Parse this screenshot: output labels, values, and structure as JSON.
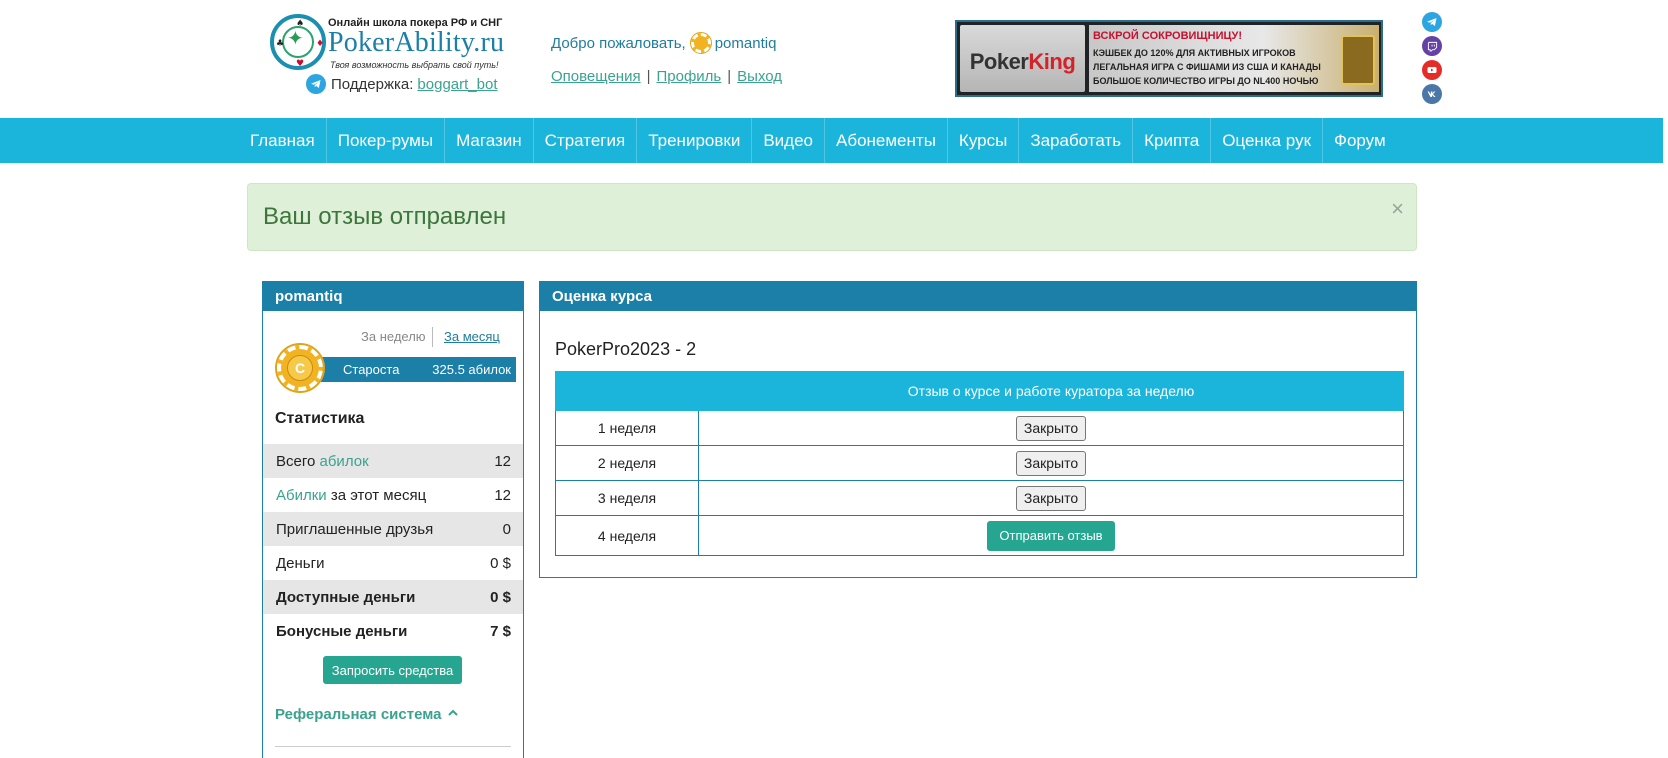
{
  "header": {
    "logo": {
      "top_line": "Онлайн школа покера РФ и СНГ",
      "name": "PokerAbility.ru",
      "slogan": "Твоя возможность выбрать свой путь!"
    },
    "support": {
      "label": "Поддержка:",
      "link": "boggart_bot"
    },
    "welcome": {
      "text": "Добро пожаловать,",
      "username": "pomantiq"
    },
    "user_links": {
      "notifications": "Оповещения",
      "profile": "Профиль",
      "logout": "Выход",
      "separator": "|"
    },
    "banner": {
      "brand_part1": "Poker",
      "brand_part2": "King",
      "title": "ВСКРОЙ СОКРОВИЩНИЦУ!",
      "lines": [
        "КЭШБЕК ДО 120% ДЛЯ АКТИВНЫХ ИГРОКОВ",
        "ЛЕГАЛЬНАЯ ИГРА С ФИШАМИ ИЗ США И КАНАДЫ",
        "БОЛЬШОЕ КОЛИЧЕСТВО ИГРЫ ДО NL400 НОЧЬЮ"
      ]
    },
    "social": [
      {
        "icon": "telegram-icon",
        "color": "#2ca5e0"
      },
      {
        "icon": "twitch-icon",
        "color": "#6441a5"
      },
      {
        "icon": "youtube-icon",
        "color": "#e52d27"
      },
      {
        "icon": "vk-icon",
        "color": "#4a76a8"
      }
    ]
  },
  "nav": {
    "items": [
      "Главная",
      "Покер-румы",
      "Магазин",
      "Стратегия",
      "Тренировки",
      "Видео",
      "Абонементы",
      "Курсы",
      "Заработать",
      "Крипта",
      "Оценка рук",
      "Форум"
    ]
  },
  "alert": {
    "text": "Ваш отзыв отправлен",
    "close": "×"
  },
  "sidebar": {
    "username": "pomantiq",
    "period_week": "За неделю",
    "period_month": "За месяц",
    "rank": {
      "chip_letter": "C",
      "title": "Староста",
      "points": "325.5 абилок"
    },
    "stats_title": "Статистика",
    "stats": [
      {
        "label_pre": "Всего ",
        "label_link": "абилок",
        "label_post": "",
        "value": "12"
      },
      {
        "label_pre": "",
        "label_link": "Абилки",
        "label_post": " за этот месяц",
        "value": "12"
      },
      {
        "label_pre": "Приглашенные друзья",
        "label_link": "",
        "label_post": "",
        "value": "0"
      },
      {
        "label_pre": "Деньги",
        "label_link": "",
        "label_post": "",
        "value": "0 $"
      },
      {
        "label_pre": "Доступные деньги",
        "label_link": "",
        "label_post": "",
        "value": "0 $"
      },
      {
        "label_pre": "Бонусные деньги",
        "label_link": "",
        "label_post": "",
        "value": "7 $"
      }
    ],
    "withdraw_button": "Запросить средства",
    "referral": "Реферальная система"
  },
  "course": {
    "panel_title": "Оценка курса",
    "name": "PokerPro2023 - 2",
    "table_header": "Отзыв о курсе и работе куратора за неделю",
    "weeks": [
      {
        "label": "1 неделя",
        "action": "Закрыто",
        "type": "closed"
      },
      {
        "label": "2 неделя",
        "action": "Закрыто",
        "type": "closed"
      },
      {
        "label": "3 неделя",
        "action": "Закрыто",
        "type": "closed"
      },
      {
        "label": "4 неделя",
        "action": "Отправить отзыв",
        "type": "send"
      }
    ]
  },
  "colors": {
    "nav": "#1bb5dc",
    "panel_header": "#1b7fa8",
    "accent_teal": "#26a690",
    "alert_bg": "#dff0d8",
    "alert_text": "#3c763d"
  }
}
